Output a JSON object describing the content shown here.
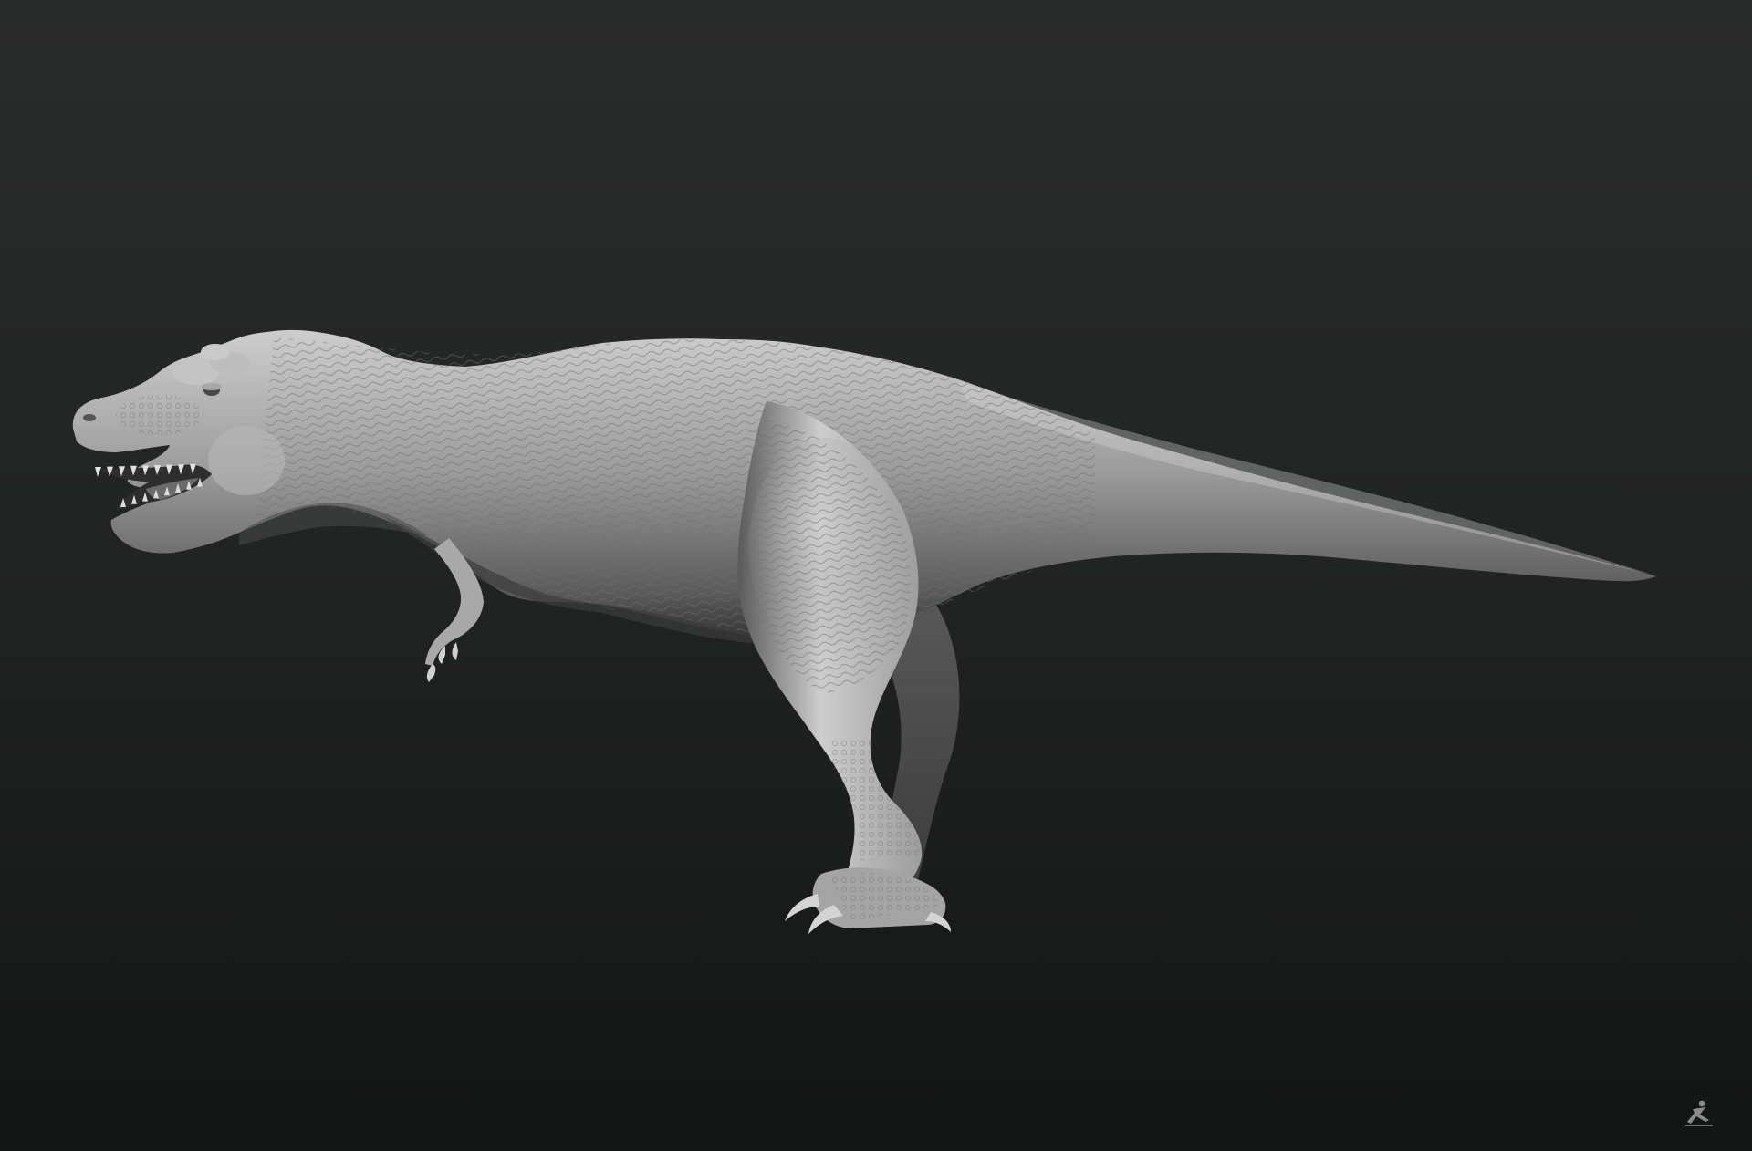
{
  "scene": {
    "subject": "trex-sculpt",
    "background": {
      "top_color": "#2a2b2b",
      "bottom_color": "#141515"
    },
    "material": {
      "light": "#cdcdcd",
      "mid": "#9c9c9c",
      "dark": "#5a5a5a",
      "shadow": "#343434"
    }
  },
  "watermark": {
    "icon": "zbrush-logo-icon",
    "color": "#8a8a8a"
  }
}
